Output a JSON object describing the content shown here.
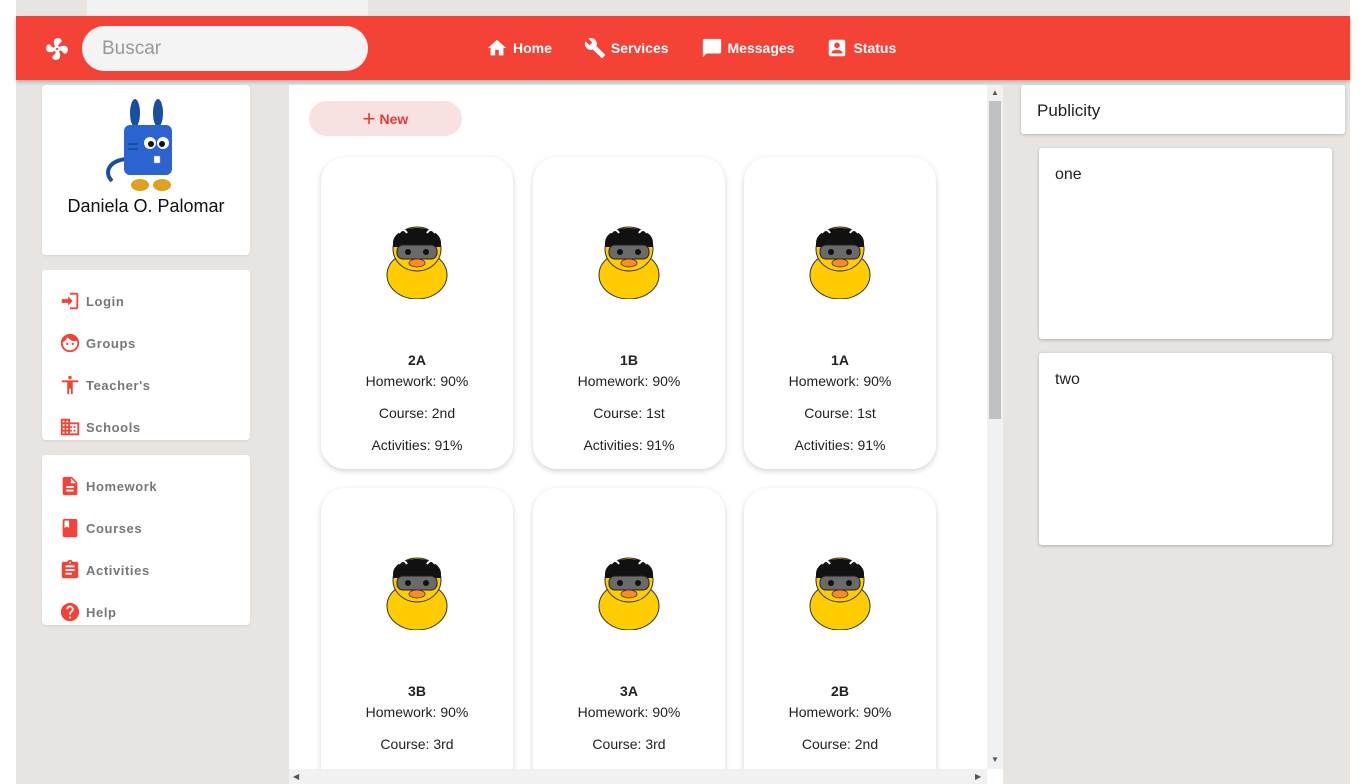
{
  "search": {
    "placeholder": "Buscar",
    "value": ""
  },
  "nav": [
    {
      "label": "Home",
      "icon": "home-icon"
    },
    {
      "label": "Services",
      "icon": "wrench-icon"
    },
    {
      "label": "Messages",
      "icon": "message-icon"
    },
    {
      "label": "Status",
      "icon": "account-box-icon"
    }
  ],
  "profile": {
    "name": "Daniela O. Palomar"
  },
  "menu1": [
    {
      "label": "Login",
      "icon": "login-icon"
    },
    {
      "label": "Groups",
      "icon": "face-icon"
    },
    {
      "label": "Teacher's",
      "icon": "person-icon"
    },
    {
      "label": "Schools",
      "icon": "building-icon"
    }
  ],
  "menu2": [
    {
      "label": "Homework",
      "icon": "document-icon"
    },
    {
      "label": "Courses",
      "icon": "book-icon"
    },
    {
      "label": "Activities",
      "icon": "clipboard-icon"
    },
    {
      "label": "Help",
      "icon": "help-icon"
    }
  ],
  "main": {
    "new_label": "New"
  },
  "groups": [
    {
      "name": "2A",
      "homework": "Homework: 90%",
      "course": "Course: 2nd",
      "activities": "Activities: 91%"
    },
    {
      "name": "1B",
      "homework": "Homework: 90%",
      "course": "Course: 1st",
      "activities": "Activities: 91%"
    },
    {
      "name": "1A",
      "homework": "Homework: 90%",
      "course": "Course: 1st",
      "activities": "Activities: 91%"
    },
    {
      "name": "3B",
      "homework": "Homework: 90%",
      "course": "Course: 3rd",
      "activities": ""
    },
    {
      "name": "3A",
      "homework": "Homework: 90%",
      "course": "Course: 3rd",
      "activities": ""
    },
    {
      "name": "2B",
      "homework": "Homework: 90%",
      "course": "Course: 2nd",
      "activities": ""
    }
  ],
  "publicity": {
    "title": "Publicity",
    "items": [
      "one",
      "two"
    ]
  },
  "colors": {
    "accent": "#f44336",
    "background": "#e8e4e2",
    "duck": "#ffcc00"
  }
}
